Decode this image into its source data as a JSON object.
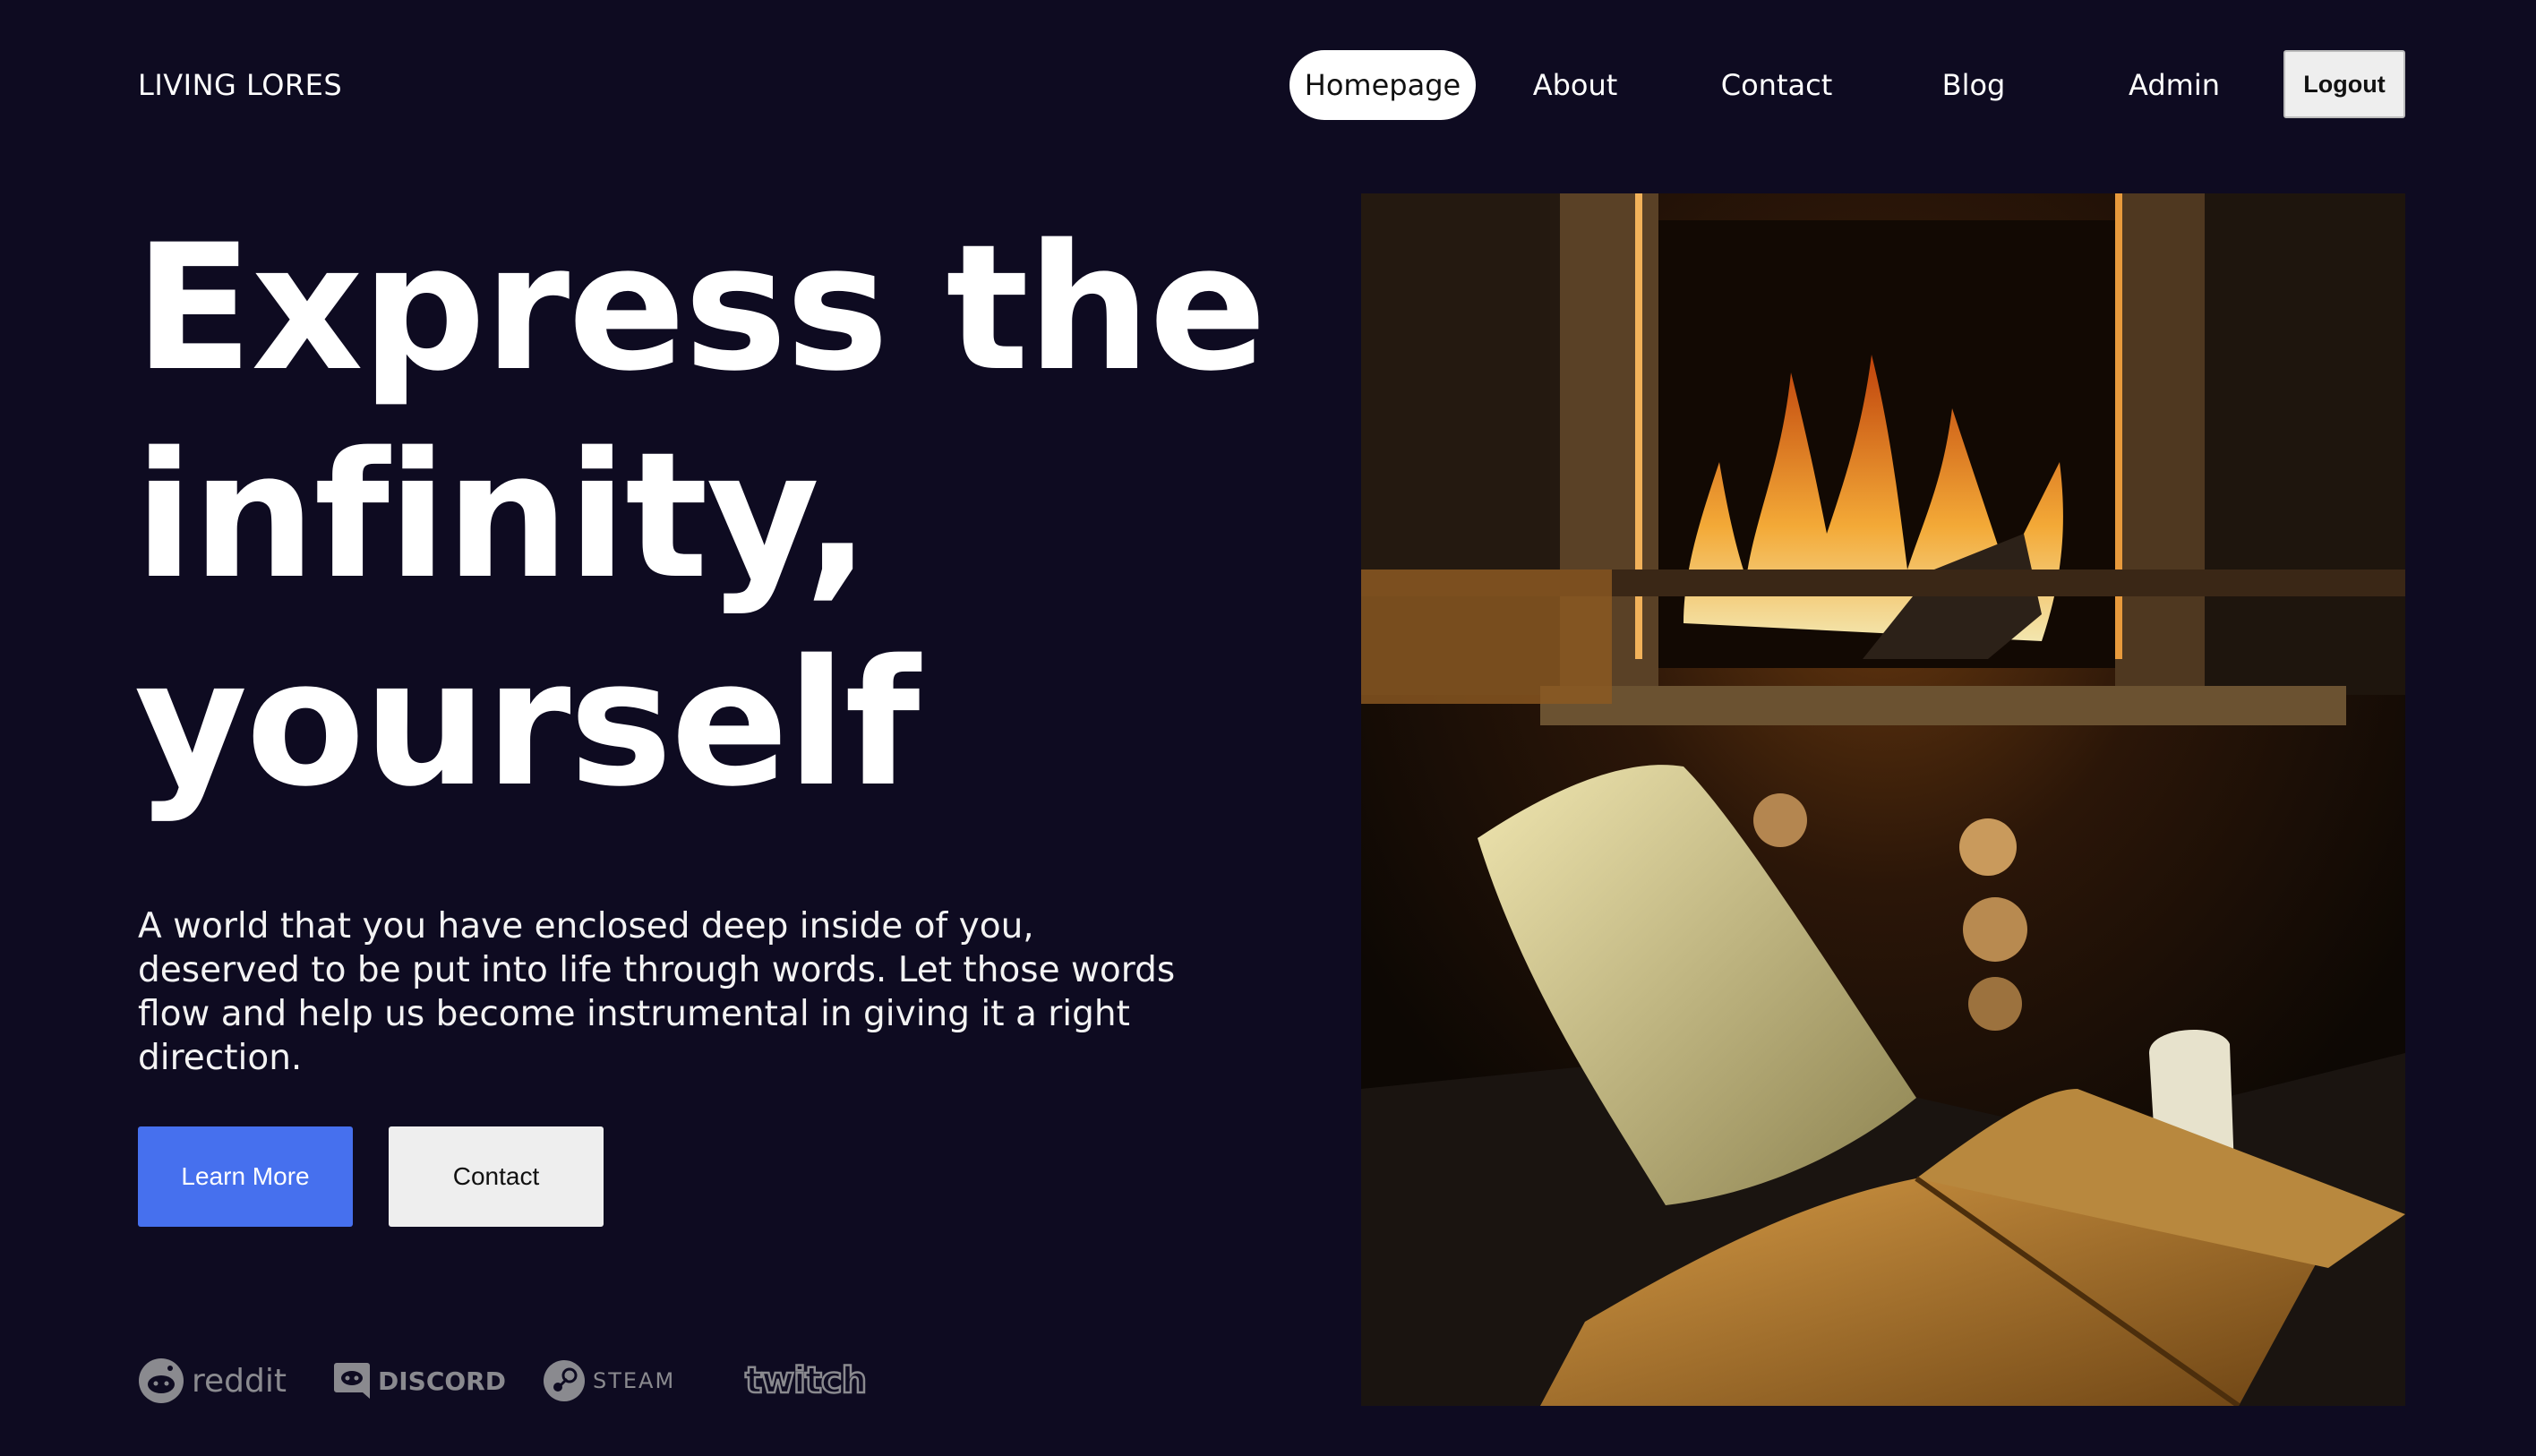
{
  "brand": {
    "name": "LIVING LORES"
  },
  "nav": {
    "items": [
      {
        "label": "Homepage",
        "active": true
      },
      {
        "label": "About",
        "active": false
      },
      {
        "label": "Contact",
        "active": false
      },
      {
        "label": "Blog",
        "active": false
      },
      {
        "label": "Admin",
        "active": false
      }
    ],
    "logout_label": "Logout"
  },
  "hero": {
    "headline_lines": [
      "Express the",
      "infinity,",
      "yourself"
    ],
    "description": "A world that you have enclosed deep inside of you, deserved to be put into life through words. Let those words flow and help us become instrumental in giving it a right direction.",
    "primary_button": "Learn More",
    "secondary_button": "Contact"
  },
  "partners": [
    {
      "name": "reddit",
      "icon": "reddit-logo"
    },
    {
      "name": "DISCORD",
      "icon": "discord-logo"
    },
    {
      "name": "STEAM",
      "icon": "steam-logo"
    },
    {
      "name": "twitch",
      "icon": "twitch-logo"
    }
  ],
  "image": {
    "subject": "fireplace-reading-nook"
  },
  "colors": {
    "background": "#0e0b21",
    "accent": "#4670ee",
    "button_light": "#eeeeee",
    "logo_gray": "#8a8a8f"
  }
}
